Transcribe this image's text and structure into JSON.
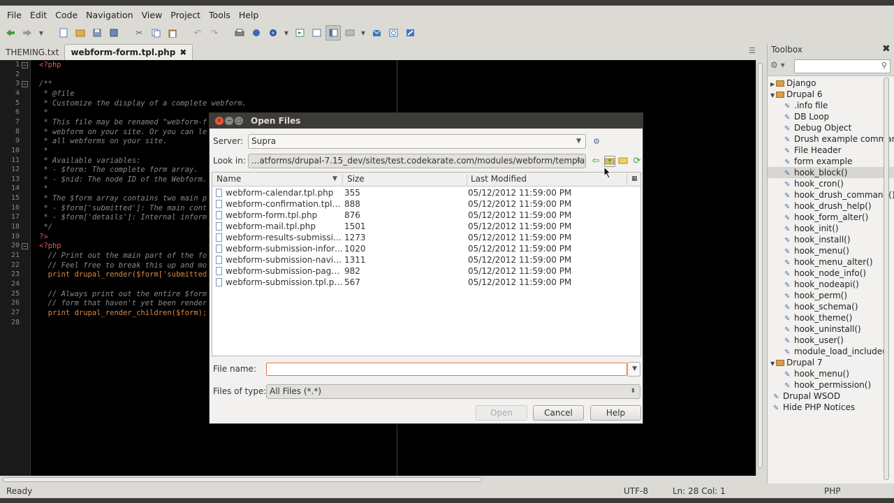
{
  "menu": [
    "File",
    "Edit",
    "Code",
    "Navigation",
    "View",
    "Project",
    "Tools",
    "Help"
  ],
  "tabs": [
    {
      "label": "THEMING.txt",
      "active": false
    },
    {
      "label": "webform-form.tpl.php",
      "active": true,
      "close": "✖"
    }
  ],
  "code_lines": [
    {
      "n": "1",
      "fold": "−",
      "t": "<?php",
      "cls": "c-php"
    },
    {
      "n": "2",
      "t": "",
      "cls": "c-cmt"
    },
    {
      "n": "3",
      "fold": "−",
      "t": "/**",
      "cls": "c-cmt"
    },
    {
      "n": "4",
      "t": " * @file",
      "cls": "c-cmt"
    },
    {
      "n": "5",
      "t": " * Customize the display of a complete webform.",
      "cls": "c-cmt"
    },
    {
      "n": "6",
      "t": " *",
      "cls": "c-cmt"
    },
    {
      "n": "7",
      "t": " * This file may be renamed \"webform-f",
      "cls": "c-cmt"
    },
    {
      "n": "8",
      "t": " * webform on your site. Or you can le",
      "cls": "c-cmt"
    },
    {
      "n": "9",
      "t": " * all webforms on your site.",
      "cls": "c-cmt"
    },
    {
      "n": "10",
      "t": " *",
      "cls": "c-cmt"
    },
    {
      "n": "11",
      "t": " * Available variables:",
      "cls": "c-cmt"
    },
    {
      "n": "12",
      "t": " * - $form: The complete form array.",
      "cls": "c-cmt"
    },
    {
      "n": "13",
      "t": " * - $nid: The node ID of the Webform.",
      "cls": "c-cmt"
    },
    {
      "n": "14",
      "t": " *",
      "cls": "c-cmt"
    },
    {
      "n": "15",
      "t": " * The $form array contains two main p",
      "cls": "c-cmt"
    },
    {
      "n": "16",
      "t": " * - $form['submitted']: The main cont",
      "cls": "c-cmt"
    },
    {
      "n": "17",
      "t": " * - $form['details']: Internal inform",
      "cls": "c-cmt"
    },
    {
      "n": "18",
      "t": " */",
      "cls": "c-cmt"
    },
    {
      "n": "19",
      "t": "?>",
      "cls": "c-php"
    },
    {
      "n": "20",
      "fold": "−",
      "t": "<?php",
      "cls": "c-php"
    },
    {
      "n": "21",
      "t": "  // Print out the main part of the fo",
      "cls": "c-cmt"
    },
    {
      "n": "22",
      "t": "  // Feel free to break this up and mo",
      "cls": "c-cmt"
    },
    {
      "n": "23",
      "t": "  print drupal_render($form['submitted",
      "cls": "c-fn"
    },
    {
      "n": "24",
      "t": "",
      "cls": "c-cmt"
    },
    {
      "n": "25",
      "t": "  // Always print out the entire $form",
      "cls": "c-cmt"
    },
    {
      "n": "26",
      "t": "  // form that haven't yet been render",
      "cls": "c-cmt"
    },
    {
      "n": "27",
      "t": "  print drupal_render_children($form);",
      "cls": "c-fn"
    },
    {
      "n": "28",
      "t": "",
      "cls": "c-cmt"
    }
  ],
  "status": {
    "state": "Ready",
    "encoding": "UTF-8",
    "position": "Ln: 28 Col: 1",
    "language": "PHP"
  },
  "toolbox": {
    "title": "Toolbox",
    "close": "✖",
    "items": [
      {
        "label": "Django",
        "type": "folder",
        "level": 0,
        "collapsed": true
      },
      {
        "label": "Drupal 6",
        "type": "folder",
        "level": 0
      },
      {
        "label": ".info file",
        "type": "snippet",
        "level": 1
      },
      {
        "label": "DB Loop",
        "type": "snippet",
        "level": 1
      },
      {
        "label": "Debug Object",
        "type": "snippet",
        "level": 1
      },
      {
        "label": "Drush example commands",
        "type": "snippet",
        "level": 1
      },
      {
        "label": "File Header",
        "type": "snippet",
        "level": 1
      },
      {
        "label": "form example",
        "type": "snippet",
        "level": 1
      },
      {
        "label": "hook_block()",
        "type": "snippet",
        "level": 1,
        "selected": true
      },
      {
        "label": "hook_cron()",
        "type": "snippet",
        "level": 1
      },
      {
        "label": "hook_drush_command()",
        "type": "snippet",
        "level": 1
      },
      {
        "label": "hook_drush_help()",
        "type": "snippet",
        "level": 1
      },
      {
        "label": "hook_form_alter()",
        "type": "snippet",
        "level": 1
      },
      {
        "label": "hook_init()",
        "type": "snippet",
        "level": 1
      },
      {
        "label": "hook_install()",
        "type": "snippet",
        "level": 1
      },
      {
        "label": "hook_menu()",
        "type": "snippet",
        "level": 1
      },
      {
        "label": "hook_menu_alter()",
        "type": "snippet",
        "level": 1
      },
      {
        "label": "hook_node_info()",
        "type": "snippet",
        "level": 1
      },
      {
        "label": "hook_nodeapi()",
        "type": "snippet",
        "level": 1
      },
      {
        "label": "hook_perm()",
        "type": "snippet",
        "level": 1
      },
      {
        "label": "hook_schema()",
        "type": "snippet",
        "level": 1
      },
      {
        "label": "hook_theme()",
        "type": "snippet",
        "level": 1
      },
      {
        "label": "hook_uninstall()",
        "type": "snippet",
        "level": 1
      },
      {
        "label": "hook_user()",
        "type": "snippet",
        "level": 1
      },
      {
        "label": "module_load_include()",
        "type": "snippet",
        "level": 1
      },
      {
        "label": "Drupal 7",
        "type": "folder",
        "level": 0
      },
      {
        "label": "hook_menu()",
        "type": "snippet",
        "level": 1
      },
      {
        "label": "hook_permission()",
        "type": "snippet",
        "level": 1
      },
      {
        "label": "Drupal WSOD",
        "type": "snippet",
        "level": 0
      },
      {
        "label": "Hide PHP Notices",
        "type": "snippet",
        "level": 0
      }
    ]
  },
  "dialog": {
    "title": "Open Files",
    "server_label": "Server:",
    "server_value": "Supra",
    "lookin_label": "Look in:",
    "lookin_value": "...atforms/drupal-7.15_dev/sites/test.codekarate.com/modules/webform/templates",
    "columns": {
      "name": "Name",
      "size": "Size",
      "modified": "Last Modified"
    },
    "files": [
      {
        "name": "webform-calendar.tpl.php",
        "size": "355",
        "modified": "05/12/2012 11:59:00 PM"
      },
      {
        "name": "webform-confirmation.tpl.php",
        "size": "888",
        "modified": "05/12/2012 11:59:00 PM"
      },
      {
        "name": "webform-form.tpl.php",
        "size": "876",
        "modified": "05/12/2012 11:59:00 PM"
      },
      {
        "name": "webform-mail.tpl.php",
        "size": "1501",
        "modified": "05/12/2012 11:59:00 PM"
      },
      {
        "name": "webform-results-submission...",
        "size": "1273",
        "modified": "05/12/2012 11:59:00 PM"
      },
      {
        "name": "webform-submission-inform...",
        "size": "1020",
        "modified": "05/12/2012 11:59:00 PM"
      },
      {
        "name": "webform-submission-naviga...",
        "size": "1311",
        "modified": "05/12/2012 11:59:00 PM"
      },
      {
        "name": "webform-submission-page.t...",
        "size": "982",
        "modified": "05/12/2012 11:59:00 PM"
      },
      {
        "name": "webform-submission.tpl.php",
        "size": "567",
        "modified": "05/12/2012 11:59:00 PM"
      }
    ],
    "filename_label": "File name:",
    "filename_value": "",
    "filetype_label": "Files of type:",
    "filetype_value": "All Files (*.*)",
    "open_label": "Open",
    "cancel_label": "Cancel",
    "help_label": "Help"
  }
}
